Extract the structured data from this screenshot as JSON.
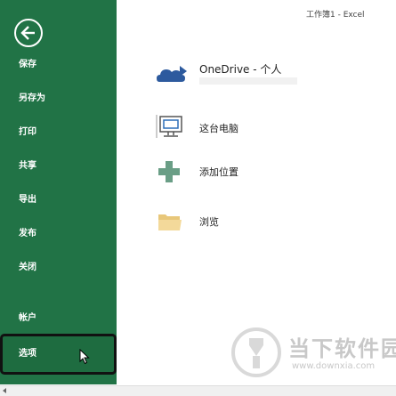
{
  "window": {
    "title": "工作簿1 - Excel"
  },
  "sidebar": {
    "background": "#217346",
    "back_icon": "back-arrow-icon",
    "items": [
      {
        "label": "保存"
      },
      {
        "label": "另存为"
      },
      {
        "label": "打印"
      },
      {
        "label": "共享"
      },
      {
        "label": "导出"
      },
      {
        "label": "发布"
      },
      {
        "label": "关闭"
      },
      {
        "label": "帐户"
      }
    ],
    "options": {
      "label": "选项",
      "highlighted": true
    }
  },
  "locations": [
    {
      "label": "OneDrive - 个人",
      "icon": "cloud-icon"
    },
    {
      "label": "这台电脑",
      "icon": "computer-icon"
    },
    {
      "label": "添加位置",
      "icon": "plus-icon"
    },
    {
      "label": "浏览",
      "icon": "folder-icon"
    }
  ],
  "watermark": {
    "text": "当下软件园",
    "url": "www.downxia.com"
  }
}
